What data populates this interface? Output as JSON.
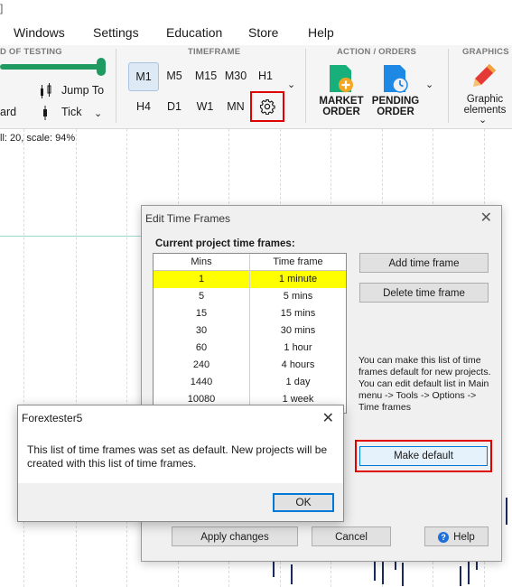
{
  "title_fragment": "]",
  "menu": {
    "items": [
      "Windows",
      "Settings",
      "Education",
      "Store",
      "Help"
    ]
  },
  "ribbon": {
    "speed_group_title": "D OF TESTING",
    "jump_to": "Jump To",
    "tick": "Tick",
    "left_fragment": "ard",
    "timeframe_title": "TIMEFRAME",
    "timeframes_row1": [
      "M1",
      "M5",
      "M15",
      "M30",
      "H1"
    ],
    "timeframes_row2": [
      "H4",
      "D1",
      "W1",
      "MN"
    ],
    "active_timeframe": "M1",
    "action_title": "ACTION / ORDERS",
    "market_order": [
      "MARKET",
      "ORDER"
    ],
    "pending_order": [
      "PENDING",
      "ORDER"
    ],
    "graphics_title": "GRAPHICS",
    "graphic_elements": [
      "Graphic",
      "elements"
    ]
  },
  "chart": {
    "info": "ll: 20, scale: 94%"
  },
  "edit_dialog": {
    "title": "Edit Time Frames",
    "section_label": "Current project time frames:",
    "columns": [
      "Mins",
      "Time frame"
    ],
    "rows": [
      {
        "mins": "1",
        "label": "1 minute",
        "selected": true
      },
      {
        "mins": "5",
        "label": "5 mins"
      },
      {
        "mins": "15",
        "label": "15 mins"
      },
      {
        "mins": "30",
        "label": "30 mins"
      },
      {
        "mins": "60",
        "label": "1 hour"
      },
      {
        "mins": "240",
        "label": "4 hours"
      },
      {
        "mins": "1440",
        "label": "1 day"
      },
      {
        "mins": "10080",
        "label": "1 week"
      }
    ],
    "add_button": "Add time frame",
    "delete_button": "Delete time frame",
    "info_text": "You can make this list of time frames default for new projects. You can edit default list in Main menu -> Tools -> Options -> Time frames",
    "make_default_button": "Make default",
    "apply_button": "Apply changes",
    "cancel_button": "Cancel",
    "help_button": "Help",
    "help_icon": "?"
  },
  "message_box": {
    "title": "Forextester5",
    "text": "This list of time frames was set as default. New projects will be created with this list of time frames.",
    "ok_button": "OK"
  },
  "colors": {
    "highlight": "#ffff00",
    "callout": "#e00000",
    "speed_slider": "#1f9a60",
    "market_icon": "#18b07a",
    "pending_icon": "#1e88e5"
  }
}
